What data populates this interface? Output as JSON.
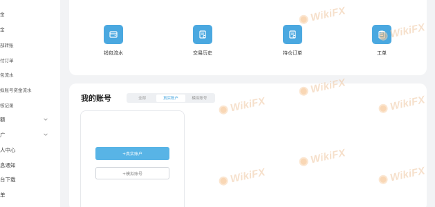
{
  "sidebar": {
    "items": [
      {
        "label": "金",
        "chevron": false
      },
      {
        "label": "金",
        "chevron": false
      },
      {
        "label": "部转账",
        "chevron": false
      },
      {
        "label": "付订单",
        "chevron": false
      },
      {
        "label": "包流水",
        "chevron": false
      },
      {
        "label": "拟账号资金流水",
        "chevron": false
      },
      {
        "label": "核记录",
        "chevron": false
      },
      {
        "label": "额",
        "chevron": true
      },
      {
        "label": "广",
        "chevron": true
      },
      {
        "label": "人中心",
        "chevron": false
      },
      {
        "label": "息通知",
        "chevron": false
      },
      {
        "label": "台下载",
        "chevron": false
      },
      {
        "label": "单",
        "chevron": false
      }
    ]
  },
  "quick_actions": [
    {
      "label": "钱包流水",
      "icon": "wallet-icon"
    },
    {
      "label": "交易历史",
      "icon": "document-icon"
    },
    {
      "label": "持仓订单",
      "icon": "document-icon"
    },
    {
      "label": "工单",
      "icon": "clipboard-icon"
    }
  ],
  "accounts": {
    "title": "我的账号",
    "tabs": [
      {
        "label": "全部",
        "active": false
      },
      {
        "label": "真实账户",
        "active": true
      },
      {
        "label": "模拟账号",
        "active": false
      }
    ],
    "add_real_label": "+真实账户",
    "add_demo_label": "+模拟账号"
  },
  "watermark": {
    "text": "WikiFX"
  },
  "colors": {
    "accent": "#4aa8e0",
    "button": "#58b4e6",
    "watermark": "#efc7a2"
  }
}
